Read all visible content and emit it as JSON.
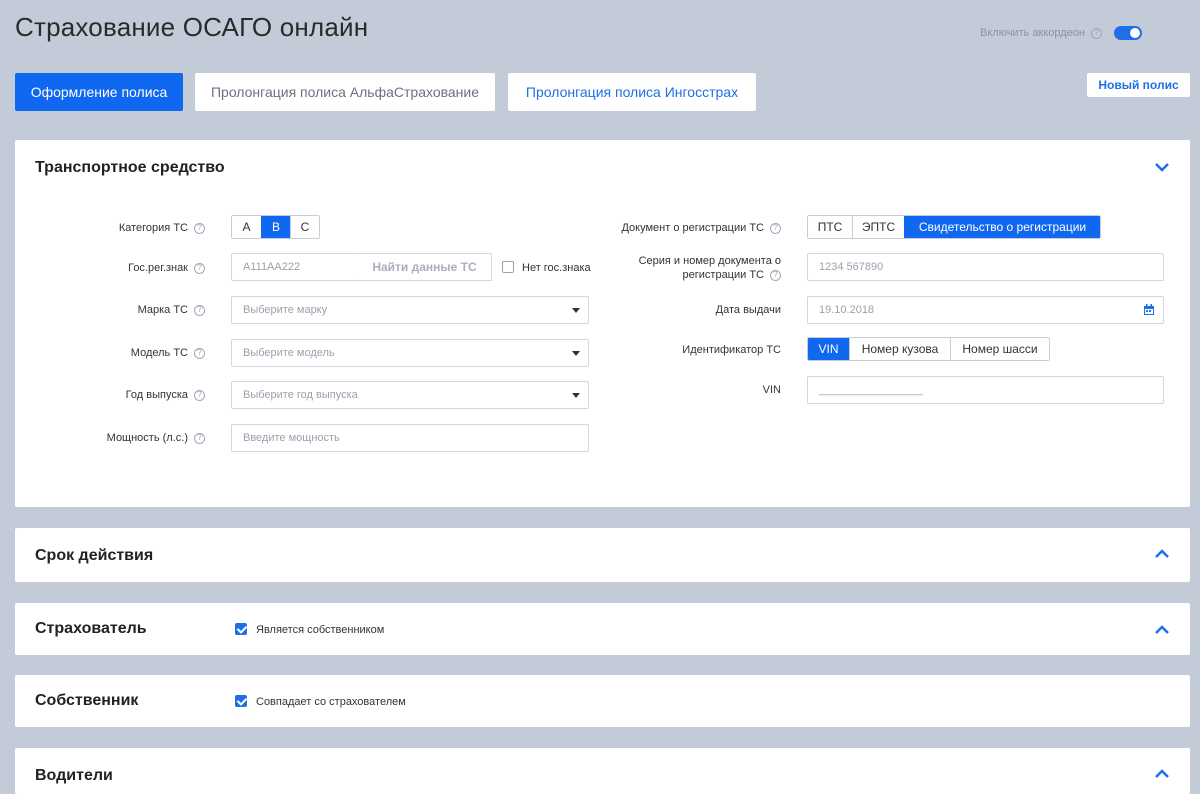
{
  "header": {
    "title": "Страхование ОСАГО онлайн",
    "accordion_label": "Включить аккордеон",
    "accordion_on": true
  },
  "tabs": [
    {
      "label": "Оформление полиса",
      "active": true
    },
    {
      "label": "Пролонгация полиса АльфаСтрахование",
      "active": false
    },
    {
      "label": "Пролонгация полиса Ингосстрах",
      "active": false
    }
  ],
  "new_policy_label": "Новый полис",
  "vehicle": {
    "title": "Транспортное средство",
    "category_label": "Категория ТС",
    "categories": [
      "A",
      "B",
      "C"
    ],
    "category_selected": "B",
    "plate_label": "Гос.рег.знак",
    "plate_placeholder": "А111АА222",
    "find_btn": "Найти данные ТС",
    "no_plate_label": "Нет гос.знака",
    "brand_label": "Марка ТС",
    "brand_placeholder": "Выберите марку",
    "model_label": "Модель ТС",
    "model_placeholder": "Выберите модель",
    "year_label": "Год выпуска",
    "year_placeholder": "Выберите год выпуска",
    "power_label": "Мощность (л.с.)",
    "power_placeholder": "Введите мощность",
    "reg_doc_label": "Документ о регистрации ТС",
    "reg_docs": [
      "ПТС",
      "ЭПТС",
      "Свидетельство о регистрации"
    ],
    "reg_doc_selected": "Свидетельство о регистрации",
    "series_label_1": "Серия и номер документа о",
    "series_label_2": "регистрации ТС",
    "series_placeholder": "1234 567890",
    "date_label": "Дата выдачи",
    "date_placeholder": "19.10.2018",
    "id_label": "Идентификатор ТС",
    "id_options": [
      "VIN",
      "Номер кузова",
      "Номер шасси"
    ],
    "id_selected": "VIN",
    "vin_label": "VIN",
    "vin_placeholder": "_________________"
  },
  "period": {
    "title": "Срок действия"
  },
  "insurer": {
    "title": "Страхователь",
    "checkbox_label": "Является собственником",
    "checked": true
  },
  "owner": {
    "title": "Собственник",
    "checkbox_label": "Совпадает со страхователем",
    "checked": true
  },
  "drivers": {
    "title": "Водители"
  },
  "colors": {
    "accent": "#1068f0",
    "background": "#c4cbd8"
  }
}
